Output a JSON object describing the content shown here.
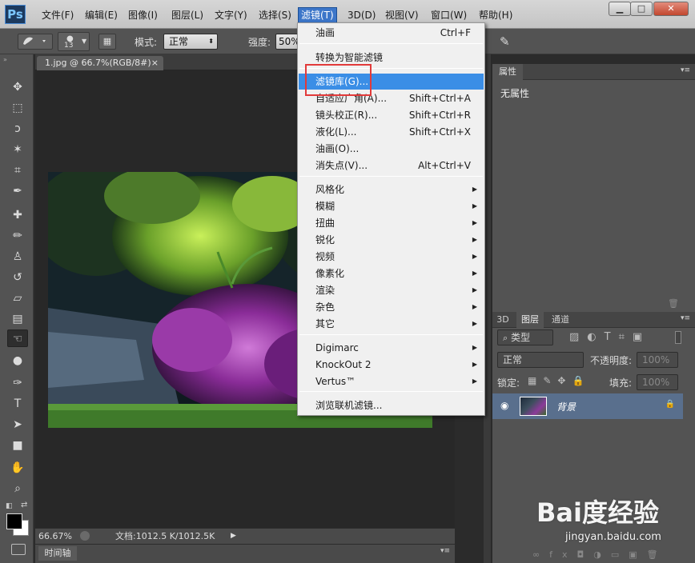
{
  "app": {
    "logo": "Ps"
  },
  "menu": {
    "items": [
      "文件(F)",
      "编辑(E)",
      "图像(I)",
      "图层(L)",
      "文字(Y)",
      "选择(S)",
      "滤镜(T)",
      "3D(D)",
      "视图(V)",
      "窗口(W)",
      "帮助(H)"
    ],
    "active": "滤镜(T)"
  },
  "window_controls": {
    "minimize": "▁",
    "maximize": "□",
    "close": "✕"
  },
  "options_bar": {
    "brush_size": "13",
    "mode_label": "模式:",
    "mode_value": "正常",
    "strength_label": "强度:",
    "strength_value": "50%"
  },
  "document": {
    "tab_title": "1.jpg @ 66.7%(RGB/8#)",
    "tab_close": "×",
    "zoom": "66.67%",
    "doc_size": "文档:1012.5 K/1012.5K"
  },
  "timeline": {
    "label": "时间轴"
  },
  "properties_panel": {
    "tab": "属性",
    "content": "无属性"
  },
  "layers_panel": {
    "tabs": [
      "3D",
      "图层",
      "通道"
    ],
    "active_tab": "图层",
    "filter_kind": "类型",
    "blend_mode": "正常",
    "opacity_label": "不透明度:",
    "opacity_value": "100%",
    "lock_label": "锁定:",
    "fill_label": "填充:",
    "fill_value": "100%",
    "layers": [
      {
        "name": "背景",
        "visible": true,
        "locked": true
      }
    ]
  },
  "filter_menu": {
    "highlighted": "滤镜库(G)...",
    "groups": [
      [
        {
          "label": "油画",
          "shortcut": "Ctrl+F"
        }
      ],
      [
        {
          "label": "转换为智能滤镜",
          "shortcut": ""
        }
      ],
      [
        {
          "label": "滤镜库(G)...",
          "shortcut": ""
        },
        {
          "label": "自适应广角(A)...",
          "shortcut": "Shift+Ctrl+A"
        },
        {
          "label": "镜头校正(R)...",
          "shortcut": "Shift+Ctrl+R"
        },
        {
          "label": "液化(L)...",
          "shortcut": "Shift+Ctrl+X"
        },
        {
          "label": "油画(O)...",
          "shortcut": ""
        },
        {
          "label": "消失点(V)...",
          "shortcut": "Alt+Ctrl+V"
        }
      ],
      [
        {
          "label": "风格化",
          "submenu": true
        },
        {
          "label": "模糊",
          "submenu": true
        },
        {
          "label": "扭曲",
          "submenu": true
        },
        {
          "label": "锐化",
          "submenu": true
        },
        {
          "label": "视频",
          "submenu": true
        },
        {
          "label": "像素化",
          "submenu": true
        },
        {
          "label": "渲染",
          "submenu": true
        },
        {
          "label": "杂色",
          "submenu": true
        },
        {
          "label": "其它",
          "submenu": true
        }
      ],
      [
        {
          "label": "Digimarc",
          "submenu": true
        },
        {
          "label": "KnockOut 2",
          "submenu": true
        },
        {
          "label": "Vertus™",
          "submenu": true
        }
      ],
      [
        {
          "label": "浏览联机滤镜...",
          "shortcut": ""
        }
      ]
    ]
  },
  "watermark": {
    "logo": "Bai度经验",
    "url": "jingyan.baidu.com"
  },
  "colors": {
    "menu_highlight": "#3b8ee6",
    "annotation": "#e23a3a",
    "layer_selected": "#596f8d"
  }
}
